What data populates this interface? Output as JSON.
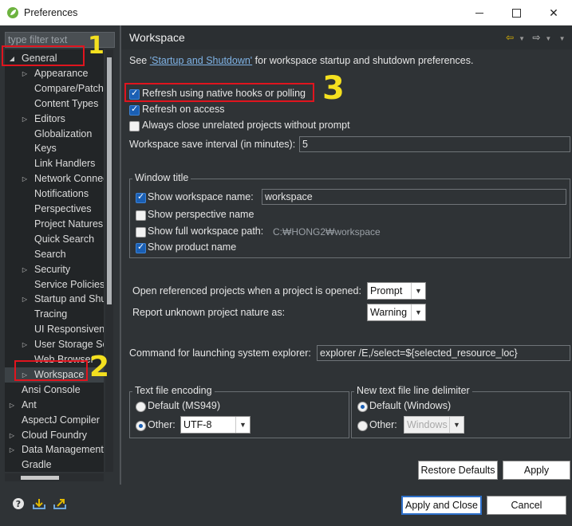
{
  "window": {
    "title": "Preferences",
    "controls": {
      "minimize": "",
      "maximize": "",
      "close": "✕"
    }
  },
  "sidebar": {
    "filter_placeholder": "type filter text",
    "items": [
      {
        "label": "General",
        "level": 0,
        "expanded": true
      },
      {
        "label": "Appearance",
        "level": 1,
        "expandable": true
      },
      {
        "label": "Compare/Patch",
        "level": 1
      },
      {
        "label": "Content Types",
        "level": 1
      },
      {
        "label": "Editors",
        "level": 1,
        "expandable": true
      },
      {
        "label": "Globalization",
        "level": 1
      },
      {
        "label": "Keys",
        "level": 1
      },
      {
        "label": "Link Handlers",
        "level": 1
      },
      {
        "label": "Network Connections",
        "level": 1,
        "expandable": true
      },
      {
        "label": "Notifications",
        "level": 1
      },
      {
        "label": "Perspectives",
        "level": 1
      },
      {
        "label": "Project Natures",
        "level": 1
      },
      {
        "label": "Quick Search",
        "level": 1
      },
      {
        "label": "Search",
        "level": 1
      },
      {
        "label": "Security",
        "level": 1,
        "expandable": true
      },
      {
        "label": "Service Policies",
        "level": 1
      },
      {
        "label": "Startup and Shutdown",
        "level": 1,
        "expandable": true
      },
      {
        "label": "Tracing",
        "level": 1
      },
      {
        "label": "UI Responsiveness",
        "level": 1
      },
      {
        "label": "User Storage Service",
        "level": 1,
        "expandable": true
      },
      {
        "label": "Web Browser",
        "level": 1
      },
      {
        "label": "Workspace",
        "level": 1,
        "expandable": true,
        "selected": true
      },
      {
        "label": "Ansi Console",
        "level": 0
      },
      {
        "label": "Ant",
        "level": 0,
        "expandable": true
      },
      {
        "label": "AspectJ Compiler",
        "level": 0
      },
      {
        "label": "Cloud Foundry",
        "level": 0,
        "expandable": true
      },
      {
        "label": "Data Management",
        "level": 0,
        "expandable": true
      },
      {
        "label": "Gradle",
        "level": 0
      }
    ]
  },
  "page": {
    "title": "Workspace",
    "intro_prefix": "See ",
    "intro_link": "'Startup and Shutdown'",
    "intro_suffix": " for workspace startup and shutdown preferences.",
    "refresh_native": {
      "label": "Refresh using native hooks or polling",
      "checked": true
    },
    "refresh_access": {
      "label": "Refresh on access",
      "checked": true
    },
    "always_close": {
      "label": "Always close unrelated projects without prompt",
      "checked": false
    },
    "save_interval": {
      "label": "Workspace save interval (in minutes):",
      "value": "5"
    },
    "window_title": {
      "group_label": "Window title",
      "show_name": {
        "label": "Show workspace name:",
        "checked": true,
        "value": "workspace"
      },
      "show_perspective": {
        "label": "Show perspective name",
        "checked": false
      },
      "show_full_path": {
        "label": "Show full workspace path:",
        "checked": false,
        "value": "C:₩HONG2₩workspace"
      },
      "show_product": {
        "label": "Show product name",
        "checked": true
      }
    },
    "open_referenced": {
      "label": "Open referenced projects when a project is opened:",
      "value": "Prompt"
    },
    "unknown_nature": {
      "label": "Report unknown project nature as:",
      "value": "Warning"
    },
    "explorer_command": {
      "label": "Command for launching system explorer:",
      "value": "explorer /E,/select=${selected_resource_loc}"
    },
    "encoding": {
      "group_label": "Text file encoding",
      "default_label": "Default (MS949)",
      "other_label": "Other:",
      "other_value": "UTF-8",
      "selected": "other"
    },
    "delimiter": {
      "group_label": "New text file line delimiter",
      "default_label": "Default (Windows)",
      "other_label": "Other:",
      "other_value": "Windows",
      "selected": "default"
    },
    "restore_defaults": "Restore Defaults",
    "apply": "Apply"
  },
  "footer": {
    "apply_close": "Apply and Close",
    "cancel": "Cancel",
    "icons": [
      "help-icon",
      "import-icon",
      "export-icon"
    ]
  },
  "annotations": {
    "one": "1",
    "two": "2",
    "three": "3"
  },
  "colors": {
    "accent": "#2d6fc9",
    "highlight": "#e0141e",
    "annotation": "#f4e01f",
    "background": "#2f3336"
  }
}
